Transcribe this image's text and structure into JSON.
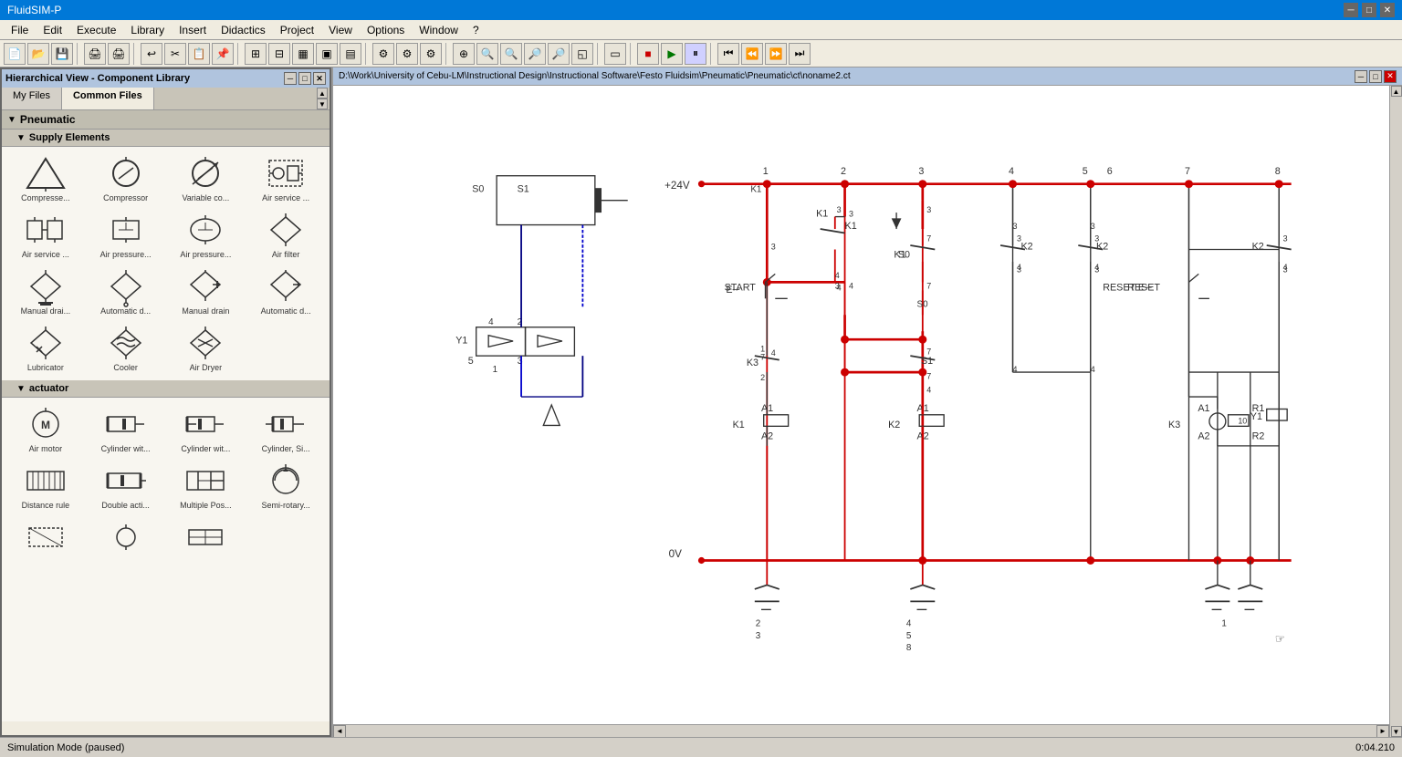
{
  "app": {
    "title": "FluidSIM-P",
    "status_text": "Simulation Mode (paused)",
    "time_display": "0:04.210"
  },
  "menu": {
    "items": [
      "File",
      "Edit",
      "Execute",
      "Library",
      "Insert",
      "Didactics",
      "Project",
      "View",
      "Options",
      "Window",
      "?"
    ]
  },
  "library_window": {
    "title": "Hierarchical View - Component Library",
    "tabs": [
      "My Files",
      "Common Files"
    ],
    "active_tab": "Common Files"
  },
  "schematic_window": {
    "title": "D:\\Work\\University of Cebu-LM\\Instructional Design\\Instructional Software\\Festo Fluidsim\\Pneumatic\\Pneumatic\\ct\\noname2.ct"
  },
  "tree": {
    "sections": [
      {
        "name": "Pneumatic",
        "expanded": true,
        "subsections": [
          {
            "name": "Supply Elements",
            "expanded": true,
            "components": [
              {
                "label": "Compresse...",
                "icon": "compressor-triangle"
              },
              {
                "label": "Compressor",
                "icon": "compressor-circle"
              },
              {
                "label": "Variable co...",
                "icon": "variable-compressor"
              },
              {
                "label": "Air service ...",
                "icon": "air-service-box"
              },
              {
                "label": "Air service ...",
                "icon": "air-service-2"
              },
              {
                "label": "Air pressure...",
                "icon": "air-pressure-rect"
              },
              {
                "label": "Air pressure...",
                "icon": "air-pressure-oval"
              },
              {
                "label": "Air filter",
                "icon": "air-filter-diamond"
              },
              {
                "label": "Manual drai...",
                "icon": "manual-drain"
              },
              {
                "label": "Automatic d...",
                "icon": "automatic-drain"
              },
              {
                "label": "Manual drain",
                "icon": "manual-drain-2"
              },
              {
                "label": "Automatic d...",
                "icon": "automatic-drain-2"
              },
              {
                "label": "Lubricator",
                "icon": "lubricator"
              },
              {
                "label": "Cooler",
                "icon": "cooler"
              },
              {
                "label": "Air Dryer",
                "icon": "air-dryer"
              }
            ]
          },
          {
            "name": "actuator",
            "expanded": true,
            "components": [
              {
                "label": "Air motor",
                "icon": "air-motor"
              },
              {
                "label": "Cylinder wit...",
                "icon": "cylinder-1"
              },
              {
                "label": "Cylinder wit...",
                "icon": "cylinder-2"
              },
              {
                "label": "Cylinder, Si...",
                "icon": "cylinder-3"
              },
              {
                "label": "Distance rule",
                "icon": "distance-rule"
              },
              {
                "label": "Double acti...",
                "icon": "double-acting"
              },
              {
                "label": "Multiple Pos...",
                "icon": "multiple-pos"
              },
              {
                "label": "Semi-rotary...",
                "icon": "semi-rotary"
              },
              {
                "label": "",
                "icon": "unknown-1"
              },
              {
                "label": "",
                "icon": "unknown-2"
              },
              {
                "label": "",
                "icon": "unknown-3"
              }
            ]
          }
        ]
      }
    ]
  },
  "colors": {
    "active_wire": "#cc0000",
    "inactive_wire": "#000000",
    "pneumatic_wire": "#0000cc",
    "supply_wire": "#cc0000",
    "highlight": "#0078d7"
  }
}
